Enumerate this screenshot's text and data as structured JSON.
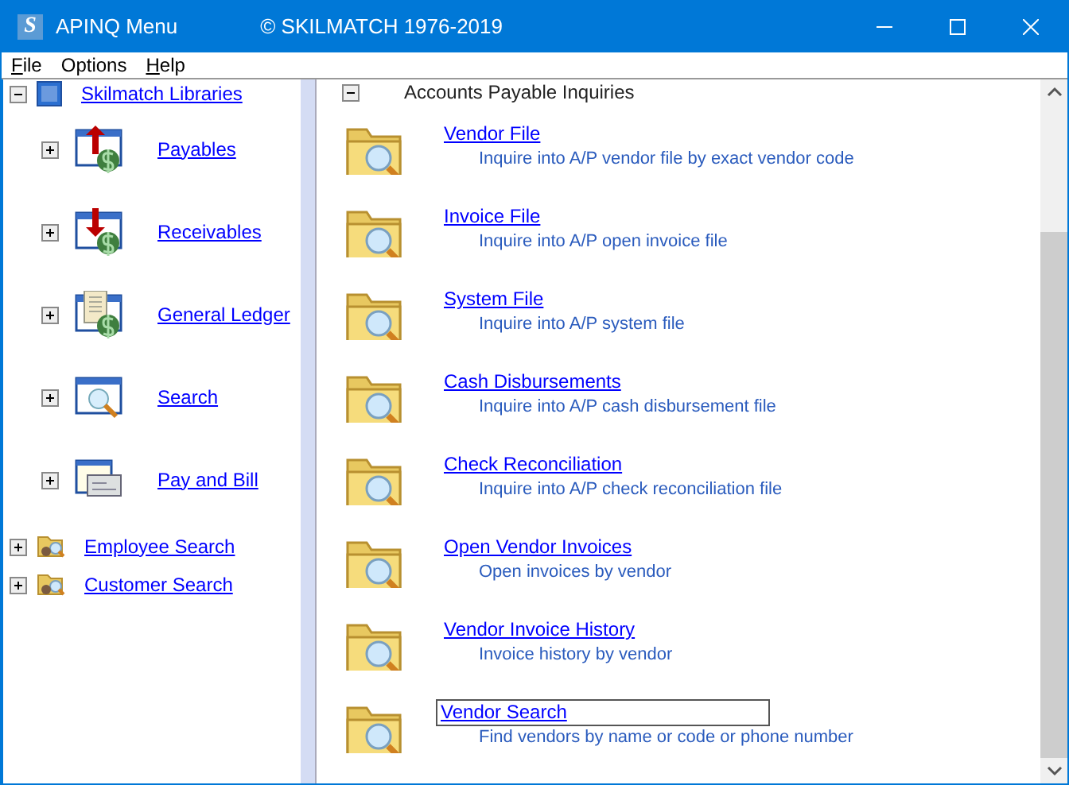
{
  "window": {
    "logo": "S",
    "title": "APINQ Menu",
    "subtitle": "© SKILMATCH 1976-2019"
  },
  "menu": [
    {
      "label": "File",
      "mnemonic": true
    },
    {
      "label": "Options",
      "mnemonic": false
    },
    {
      "label": "Help",
      "mnemonic": true
    }
  ],
  "tree": [
    {
      "label": "Skilmatch Libraries",
      "kind": "library",
      "expanded": true,
      "children": [
        {
          "label": "Payables",
          "kind": "payables",
          "expanded": false
        },
        {
          "label": "Receivables",
          "kind": "receivables",
          "expanded": false
        },
        {
          "label": "General Ledger",
          "kind": "ledger",
          "expanded": false
        },
        {
          "label": "Search",
          "kind": "search",
          "expanded": false
        },
        {
          "label": "Pay and Bill",
          "kind": "check",
          "expanded": false
        }
      ]
    },
    {
      "label": "Employee Search",
      "kind": "folder-search",
      "expanded": false
    },
    {
      "label": "Customer Search",
      "kind": "folder-search",
      "expanded": false
    }
  ],
  "panel": {
    "title": "Accounts Payable Inquiries",
    "expanded": true,
    "items": [
      {
        "title": "Vendor File",
        "description": "Inquire into A/P vendor file by exact vendor code",
        "selected": false
      },
      {
        "title": "Invoice File",
        "description": "Inquire into A/P open invoice file",
        "selected": false
      },
      {
        "title": "System File",
        "description": "Inquire into A/P system file",
        "selected": false
      },
      {
        "title": "Cash Disbursements",
        "description": "Inquire into A/P cash disbursement file",
        "selected": false
      },
      {
        "title": "Check Reconciliation",
        "description": "Inquire into A/P check reconciliation file",
        "selected": false
      },
      {
        "title": "Open Vendor Invoices",
        "description": "Open invoices by vendor",
        "selected": false
      },
      {
        "title": "Vendor Invoice History",
        "description": "Invoice history by vendor",
        "selected": false
      },
      {
        "title": "Vendor Search",
        "description": "Find vendors by name or code or phone number",
        "selected": true
      }
    ]
  }
}
